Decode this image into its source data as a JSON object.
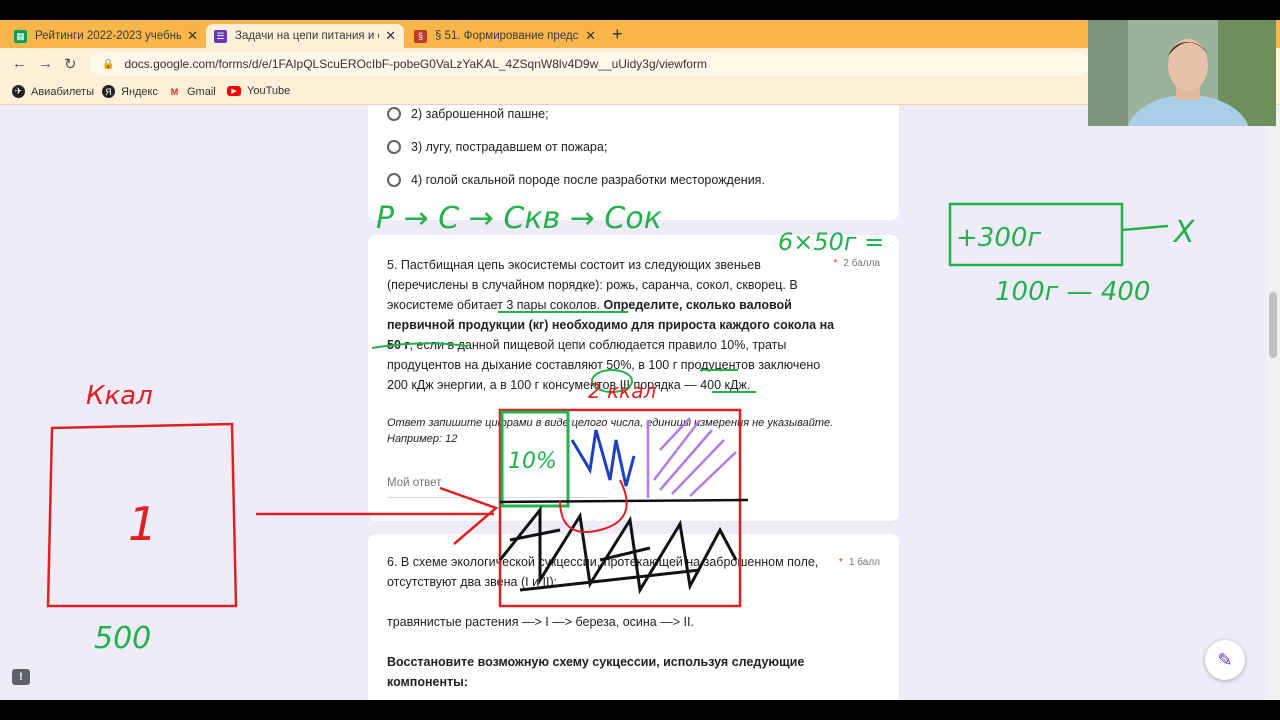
{
  "tabs": [
    {
      "title": "Рейтинги 2022-2023 учебный го",
      "favicon": "sheets-icon",
      "color": "#0f9d58"
    },
    {
      "title": "Задачи на цепи питания и сукц",
      "favicon": "forms-icon",
      "color": "#673ab7"
    },
    {
      "title": "§ 51. Формирование представле",
      "favicon": "book-icon",
      "color": "#c0392b"
    }
  ],
  "new_tab_label": "+",
  "address": {
    "url": "docs.google.com/forms/d/e/1FAIpQLScuEROcIbF-pobeG0VaLzYaKAL_4ZSqnW8lv4D9w__uUidy3g/viewform"
  },
  "bookmarks": [
    {
      "label": "Авиабилеты",
      "icon": "plane-icon"
    },
    {
      "label": "Яндекс",
      "icon": "yandex-icon"
    },
    {
      "label": "Gmail",
      "icon": "gmail-icon"
    },
    {
      "label": "YouTube",
      "icon": "youtube-icon"
    }
  ],
  "q4": {
    "options": [
      "2) заброшенной пашне;",
      "3) лугу, пострадавшем от пожара;",
      "4) голой скальной породе после разработки месторождения."
    ]
  },
  "q5": {
    "text_plain": "5. Пастбищная цепь экосистемы состоит из следующих звеньев (перечислены в случайном порядке): рожь, саранча, сокол, скворец. В экосистеме обитает 3 пары соколов. ",
    "text_bold": "Определите, сколько валовой первичной продукции (кг) необходимо для прироста каждого сокола на 50 г",
    "text_tail": ", если в данной пищевой цепи соблюдается правило 10%, траты продуцентов на дыхание составляют 50%, в 100 г продуцентов заключено 200 кДж энергии, а в 100 г консументов III порядка — 400 кДж.",
    "points": "2 балла",
    "hint": "Ответ запишите цифрами в виде целого числа, единицы измерения не указывайте. Например: 12",
    "answer_placeholder": "Мой ответ"
  },
  "q6": {
    "text": "6. В схеме экологической сукцессии, протекающей на заброшенном поле, отсутствуют два звена (I и II):",
    "points": "1 балл",
    "scheme": "травянистые растения —> I —> береза, осина —> II.",
    "instruction": "Восстановите возможную схему сукцессии, используя следующие компоненты:"
  },
  "required_mark": "*",
  "annotations": {
    "chain": "Р → С → Скв → Сок",
    "formula": "6×50г =",
    "box_value": "+300г",
    "arrow_target": "X",
    "ratio": "100г — 400",
    "unit": "Ккал",
    "box_number": "1",
    "box_bottom": "500",
    "percent": "10%",
    "note": "2 ккал"
  },
  "colors": {
    "ink_green": "#22b14c",
    "ink_red": "#e02020",
    "ink_blue": "#1f3fbf",
    "ink_purple": "#b57be0",
    "ink_black": "#111111"
  }
}
